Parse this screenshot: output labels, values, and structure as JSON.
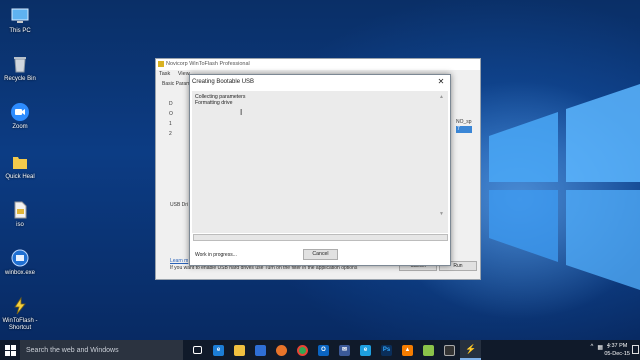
{
  "desktop": {
    "icons": [
      {
        "label": "This PC",
        "icon": "computer-icon"
      },
      {
        "label": "Recycle Bin",
        "icon": "recycle-bin-icon"
      },
      {
        "label": "Zoom",
        "icon": "zoom-icon"
      },
      {
        "label": "Quick Heal",
        "icon": "folder-icon"
      },
      {
        "label": "iso",
        "icon": "file-icon"
      },
      {
        "label": "winbox.exe",
        "icon": "winbox-icon"
      },
      {
        "label": "WinToFlash - Shortcut",
        "icon": "wintoflash-shortcut-icon"
      }
    ]
  },
  "background_window": {
    "title": "Novicorp WinToFlash Professional",
    "menu": [
      "Task",
      "View"
    ],
    "tab": "Basic Param",
    "left_column": [
      "D",
      "O",
      "1",
      "2"
    ],
    "right_column": [
      "NO_sp",
      "7"
    ],
    "usb_label": "USB Dri",
    "learn_more": "Learn m",
    "hint": "If you want to enable USB hard drives use Turn on the filter in the application options",
    "buttons": [
      "Cancel",
      "Run"
    ]
  },
  "dialog": {
    "title": "Creating Bootable USB",
    "log_lines": [
      "Collecting parameters",
      "Formatting drive"
    ],
    "progress": 0,
    "status": "Work in progress...",
    "cancel_label": "Cancel",
    "accent": "#06b025"
  },
  "taskbar": {
    "search_placeholder": "Search the web and Windows",
    "pinned": [
      "task-view-icon",
      "edge-icon",
      "file-explorer-icon",
      "store-icon",
      "firefox-icon",
      "chrome-icon",
      "outlook-icon",
      "mail-icon",
      "ie-icon",
      "photoshop-icon",
      "vlc-icon",
      "app-icon",
      "terminal-icon",
      "wintoflash-icon"
    ],
    "time": "4:37 PM",
    "date": "05-Dec-15"
  }
}
